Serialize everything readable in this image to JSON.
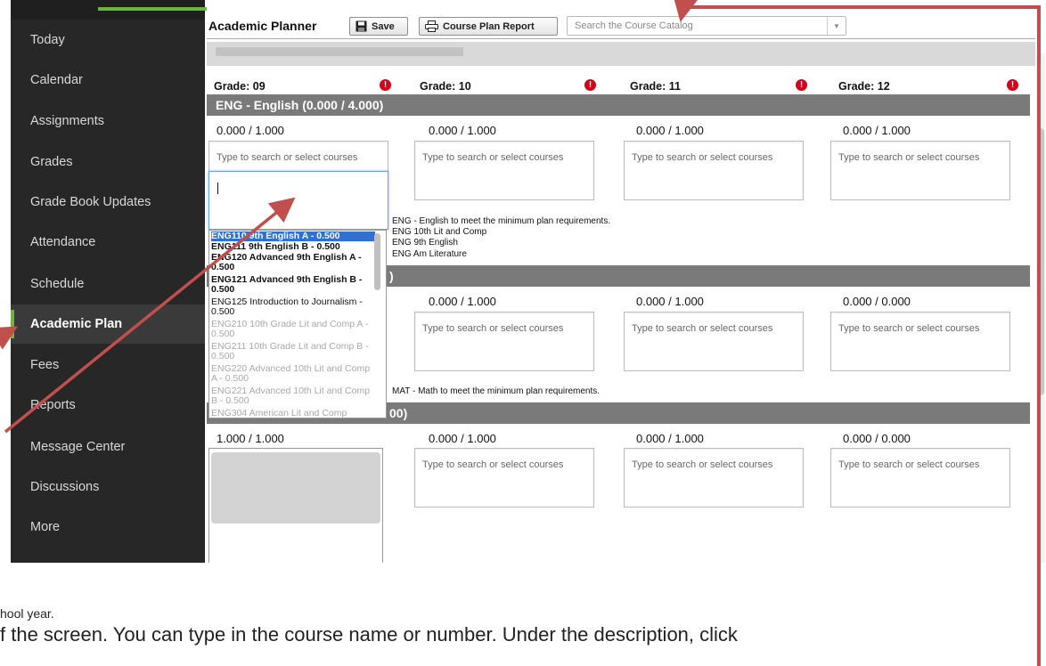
{
  "sidebar": {
    "items": [
      {
        "label": "Today"
      },
      {
        "label": "Calendar"
      },
      {
        "label": "Assignments"
      },
      {
        "label": "Grades"
      },
      {
        "label": "Grade Book Updates"
      },
      {
        "label": "Attendance"
      },
      {
        "label": "Schedule"
      },
      {
        "label": "Academic Plan"
      },
      {
        "label": "Fees"
      },
      {
        "label": "Reports"
      },
      {
        "label": "Message Center"
      },
      {
        "label": "Discussions"
      },
      {
        "label": "More"
      }
    ],
    "active": "Academic Plan",
    "accent_color": "#6cb33f"
  },
  "toolbar": {
    "title": "Academic Planner",
    "save_label": "Save",
    "report_label": "Course Plan Report",
    "catalog_placeholder": "Search the Course Catalog"
  },
  "grades": [
    {
      "label": "Grade: 09"
    },
    {
      "label": "Grade: 10"
    },
    {
      "label": "Grade: 11"
    },
    {
      "label": "Grade: 12"
    }
  ],
  "alert_symbol": "!",
  "sections": [
    {
      "title": "ENG - English (0.000 / 4.000)",
      "credits": [
        "0.000 / 1.000",
        "0.000 / 1.000",
        "0.000 / 1.000",
        "0.000 / 1.000"
      ],
      "notes": [
        "ENG - English to meet the minimum plan requirements.",
        "ENG 10th Lit and Comp",
        "ENG 9th English",
        "ENG Am Literature"
      ]
    },
    {
      "title_fragment": ")",
      "credits": [
        "0.000 / 1.000",
        "0.000 / 1.000",
        "0.000 / 0.000"
      ],
      "notes": [
        "MAT - Math to meet the minimum plan requirements."
      ]
    },
    {
      "title_fragment": "00)",
      "credits": [
        "1.000 / 1.000",
        "0.000 / 1.000",
        "0.000 / 1.000",
        "0.000 / 0.000"
      ]
    }
  ],
  "course_placeholder": "Type to search or select courses",
  "dropdown_options": [
    {
      "text": "ENG110 9th English A - 0.500",
      "style": "hl"
    },
    {
      "text": "ENG111 9th English B - 0.500",
      "style": "bold"
    },
    {
      "text": "ENG120 Advanced 9th English A - 0.500",
      "style": "bold"
    },
    {
      "text": "ENG121 Advanced 9th English B - 0.500",
      "style": "bold"
    },
    {
      "text": "ENG125 Introduction to Journalism - 0.500",
      "style": "normal"
    },
    {
      "text": "ENG210 10th Grade Lit and Comp A - 0.500",
      "style": "dim"
    },
    {
      "text": "ENG211 10th Grade Lit and Comp B - 0.500",
      "style": "dim"
    },
    {
      "text": "ENG220 Advanced 10th Lit and Comp A - 0.500",
      "style": "dim"
    },
    {
      "text": "ENG221 Advanced 10th Lit and Comp B - 0.500",
      "style": "dim"
    },
    {
      "text": "ENG304 American Lit and Comp",
      "style": "dim"
    }
  ],
  "document_text": {
    "line1": "hool year.",
    "line2": "f the screen. You can type in the course name or number. Under the description, click"
  },
  "annotation_color": "#c0504d",
  "section_bar_color": "#7a7a7a"
}
